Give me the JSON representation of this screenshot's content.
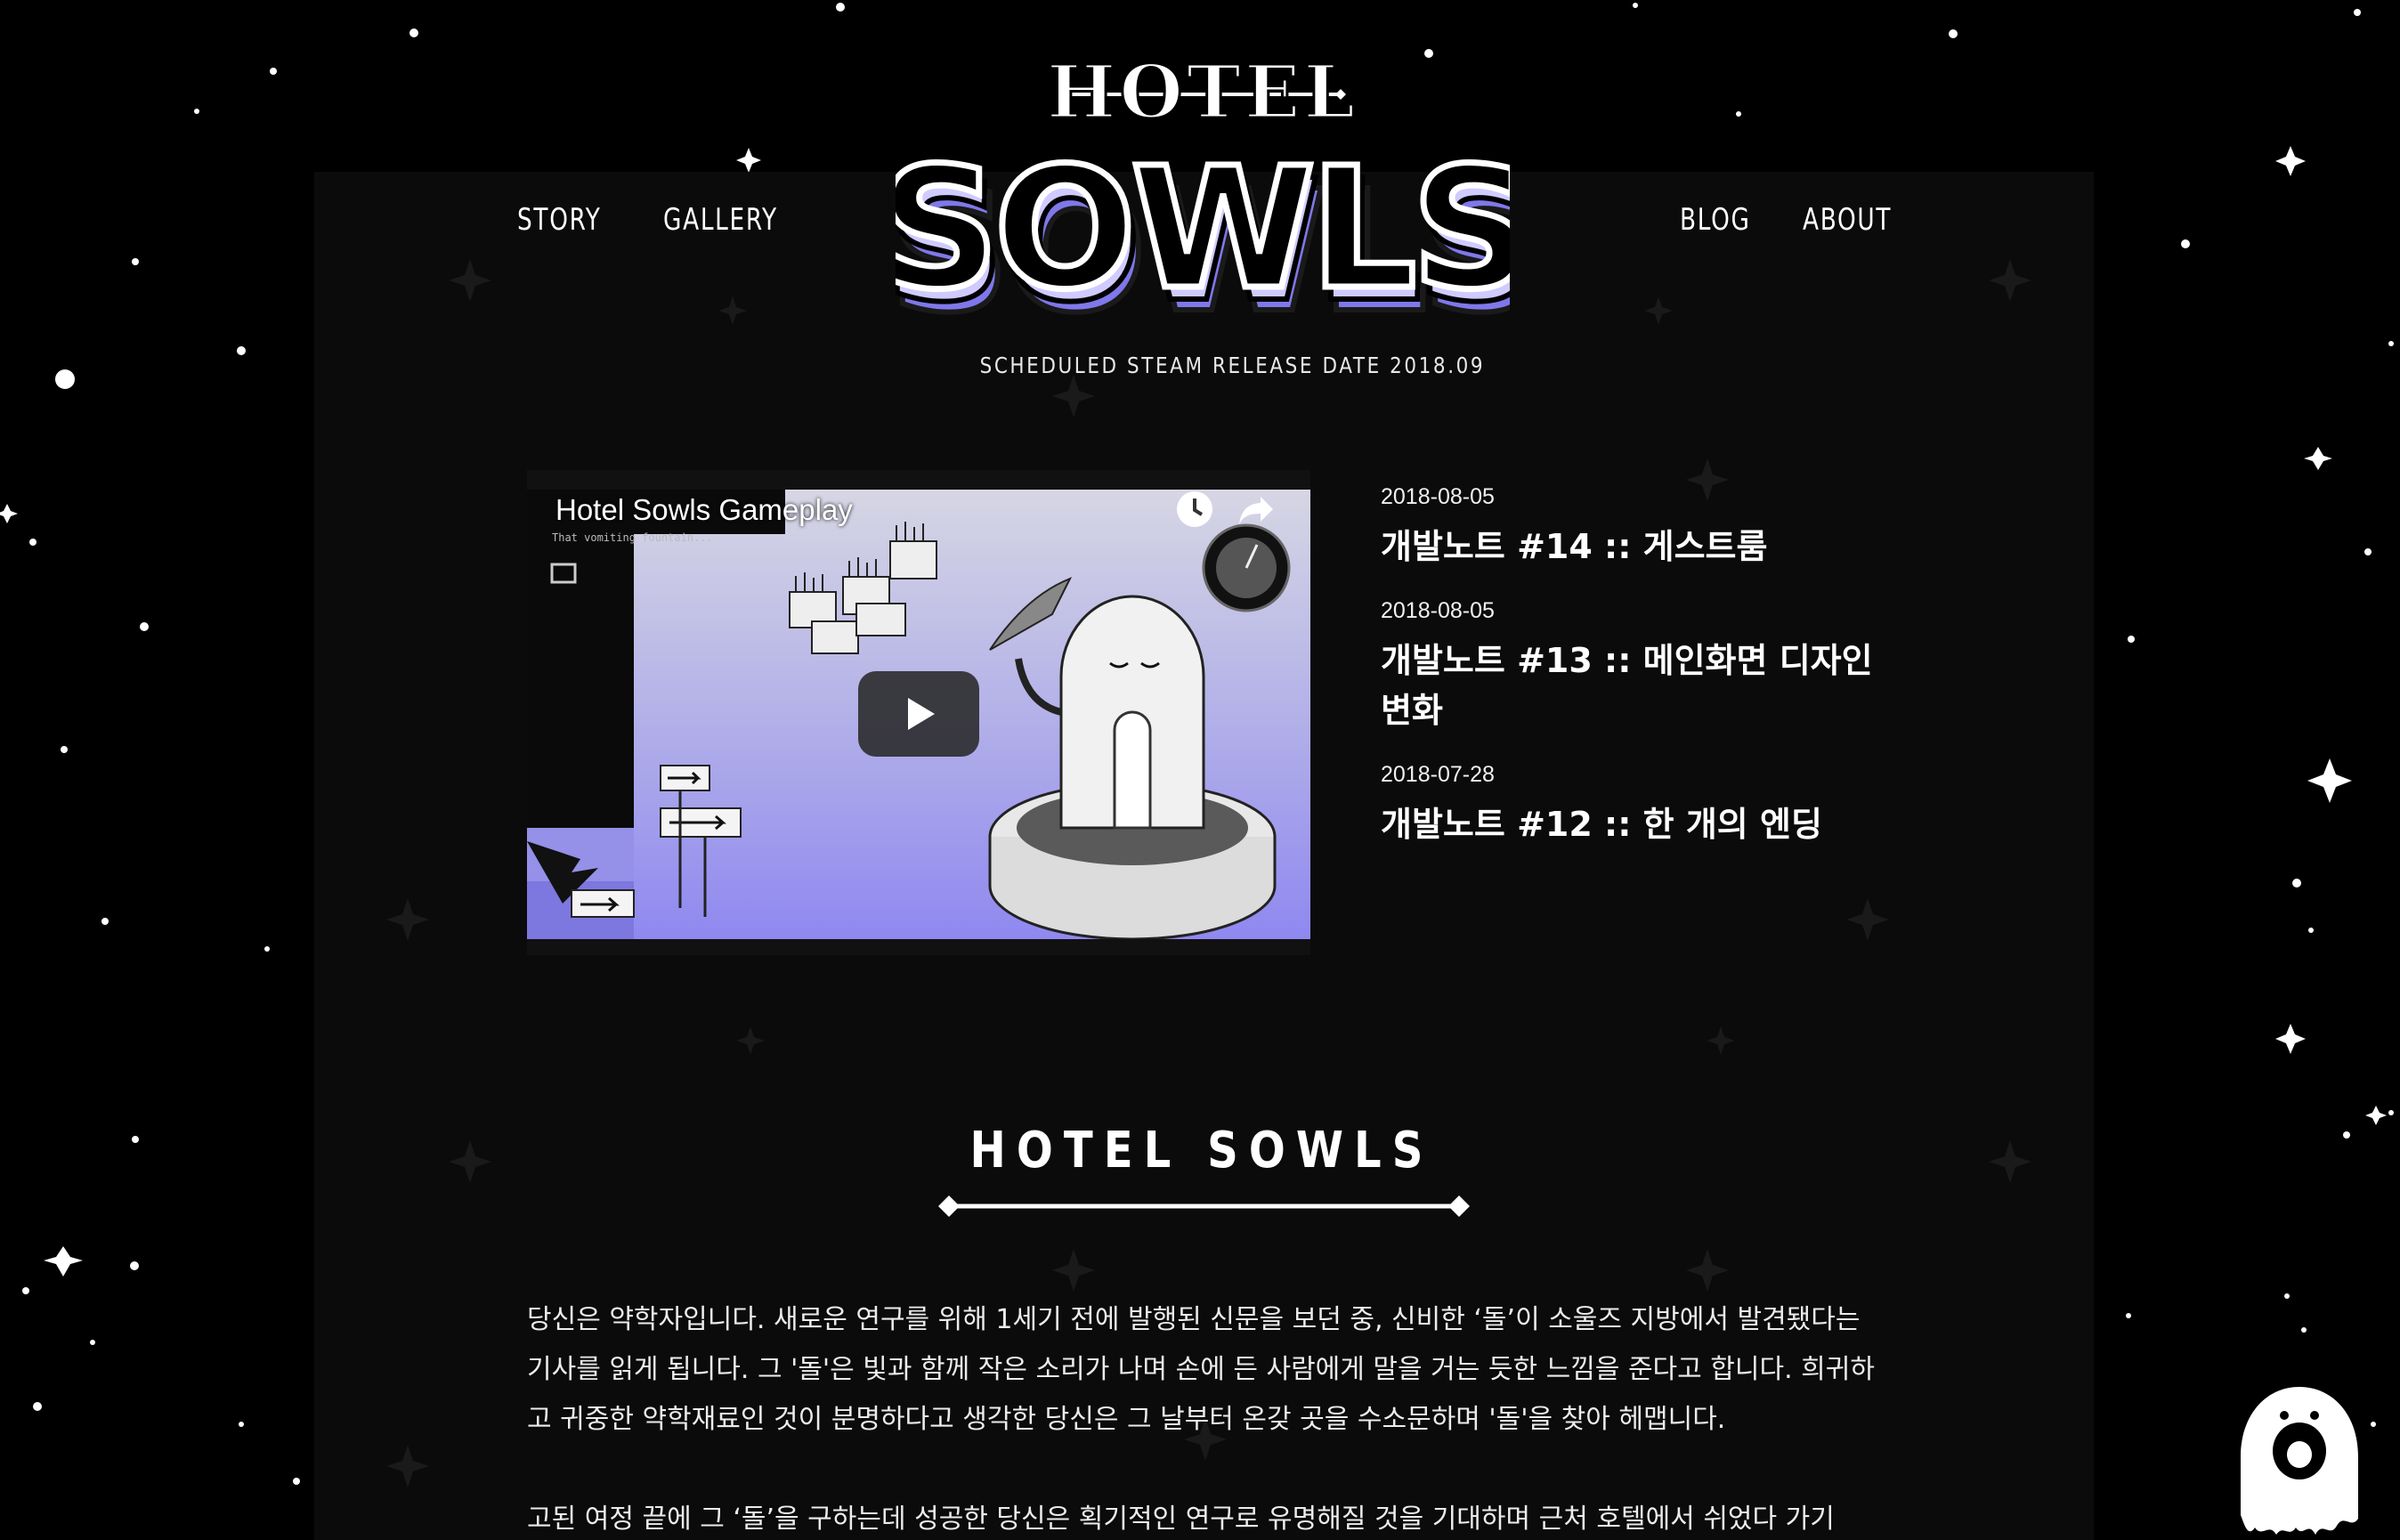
{
  "nav": {
    "story": "STORY",
    "gallery": "GALLERY",
    "blog": "BLOG",
    "about": "ABOUT"
  },
  "logo": {
    "top_word": "HOTEL",
    "main_word": "SOWLS"
  },
  "release": "SCHEDULED STEAM RELEASE DATE 2018.09",
  "video": {
    "title": "Hotel Sowls Gameplay",
    "ingame_caption": "That vomiting fountain...",
    "icons": [
      "clock-icon",
      "share-icon",
      "play-icon"
    ]
  },
  "posts": [
    {
      "date": "2018-08-05",
      "title": "개발노트 #14 :: 게스트룸"
    },
    {
      "date": "2018-08-05",
      "title": "개발노트 #13 :: 메인화면 디자인 변화"
    },
    {
      "date": "2018-07-28",
      "title": "개발노트 #12 :: 한 개의 엔딩"
    }
  ],
  "section": {
    "title": "HOTEL SOWLS",
    "paragraphs": [
      "당신은 약학자입니다. 새로운 연구를 위해 1세기 전에 발행된 신문을 보던 중, 신비한 ‘돌’이 소울즈 지방에서 발견됐다는 기사를 읽게 됩니다. 그 '돌'은 빛과 함께 작은 소리가 나며 손에 든 사람에게 말을 거는 듯한 느낌을 준다고 합니다. 희귀하고 귀중한 약학재료인 것이 분명하다고 생각한 당신은 그 날부터 온갖 곳을 수소문하며 '돌'을 찾아 헤맵니다.",
      "고된 여정 끝에 그 ‘돌’을 구하는데 성공한 당신은 획기적인 연구로 유명해질 것을 기대하며 근처 호텔에서 쉬었다 가기"
    ]
  },
  "colors": {
    "background": "#000000",
    "panel": "#0b0b0b",
    "accent_lavender": "#8c86f2",
    "text": "#ffffff"
  }
}
